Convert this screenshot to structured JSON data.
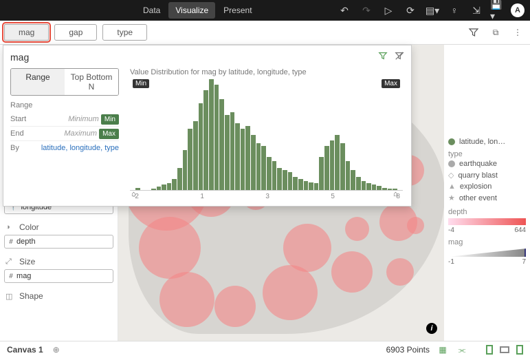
{
  "topbar": {
    "tabs": {
      "data": "Data",
      "visualize": "Visualize",
      "present": "Present"
    },
    "avatar": "A"
  },
  "pills": {
    "mag": "mag",
    "gap": "gap",
    "type": "type"
  },
  "popup": {
    "title": "mag",
    "seg": {
      "range": "Range",
      "topn": "Top Bottom N"
    },
    "range_label": "Range",
    "start": "Start",
    "start_val": "Minimum",
    "start_badge": "Min",
    "end": "End",
    "end_val": "Maximum",
    "end_badge": "Max",
    "by": "By",
    "by_link": "latitude, longitude, type",
    "dist_title": "Value Distribution for mag by latitude, longitude, type",
    "min_tag": "Min",
    "max_tag": "Max"
  },
  "chart_data": {
    "type": "bar",
    "title": "Value Distribution for mag by latitude, longitude, type",
    "xlabel": "",
    "ylabel": "",
    "xlim": [
      -2,
      8
    ],
    "axis_ticks": [
      "-2",
      "1",
      "3",
      "5",
      "8"
    ],
    "categories": [
      -2,
      -1.8,
      -1.6,
      -1.4,
      -1.2,
      -1,
      -0.8,
      -0.6,
      -0.4,
      -0.2,
      0,
      0.2,
      0.4,
      0.6,
      0.8,
      1,
      1.2,
      1.4,
      1.6,
      1.8,
      2,
      2.2,
      2.4,
      2.6,
      2.8,
      3,
      3.2,
      3.4,
      3.6,
      3.8,
      4,
      4.2,
      4.4,
      4.6,
      4.8,
      5,
      5.2,
      5.4,
      5.6,
      5.8,
      6,
      6.2,
      6.4,
      6.6,
      6.8,
      7,
      7.2,
      7.4,
      7.6,
      7.8
    ],
    "values": [
      2,
      0,
      0,
      1,
      3,
      5,
      6,
      10,
      20,
      36,
      55,
      62,
      78,
      90,
      100,
      95,
      82,
      68,
      70,
      60,
      55,
      58,
      50,
      42,
      40,
      30,
      26,
      20,
      18,
      16,
      12,
      10,
      8,
      7,
      6,
      30,
      40,
      45,
      50,
      42,
      26,
      18,
      12,
      8,
      6,
      5,
      4,
      2,
      1,
      1
    ]
  },
  "leftcol": {
    "longitude": "longitude",
    "color": "Color",
    "color_val": "depth",
    "size": "Size",
    "size_val": "mag",
    "shape": "Shape"
  },
  "legend": {
    "category_field": "latitude, lon…",
    "type_label": "type",
    "types": {
      "earthquake": "earthquake",
      "quarry": "quarry blast",
      "explosion": "explosion",
      "other": "other event"
    },
    "depth_label": "depth",
    "depth_min": "-4",
    "depth_max": "644",
    "mag_label": "mag",
    "mag_min": "-1",
    "mag_max": "7"
  },
  "footer": {
    "canvas": "Canvas 1",
    "points": "6903 Points"
  }
}
